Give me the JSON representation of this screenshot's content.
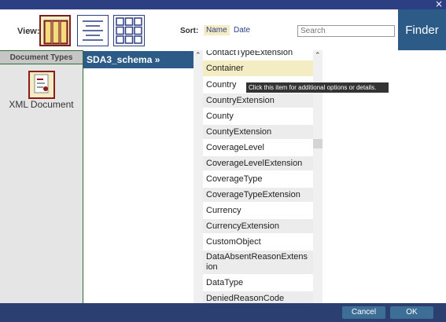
{
  "window": {
    "close_glyph": "×"
  },
  "toolbar": {
    "view_label": "View:",
    "view_modes": [
      "columns-view-icon",
      "list-view-icon",
      "grid-view-icon"
    ],
    "sort_label": "Sort:",
    "sort_options": {
      "name": "Name",
      "date": "Date"
    },
    "search_placeholder": "Search",
    "finder_label": "Finder"
  },
  "left_panel": {
    "header": "Document Types",
    "items": [
      {
        "label": "XML Document",
        "icon": "xml-document-icon"
      }
    ]
  },
  "column1": {
    "header": "SDA3_schema »"
  },
  "list": {
    "items": [
      "ContactTypeExtension",
      "Container",
      "Country",
      "CountryExtension",
      "County",
      "CountyExtension",
      "CoverageLevel",
      "CoverageLevelExtension",
      "CoverageType",
      "CoverageTypeExtension",
      "Currency",
      "CurrencyExtension",
      "CustomObject",
      "DataAbsentReasonExtens",
      "ion",
      "DataType",
      "DeniedReasonCode"
    ],
    "selected": "Container"
  },
  "tooltip": "Click this item for additional options or details.",
  "footer": {
    "cancel_label": "Cancel",
    "ok_label": "OK"
  },
  "colors": {
    "topbar": "#2c3f83",
    "finder": "#2b5b86",
    "highlight": "#f4ecc2",
    "selection_border": "#7a1f1f",
    "footer": "#2b4070"
  }
}
